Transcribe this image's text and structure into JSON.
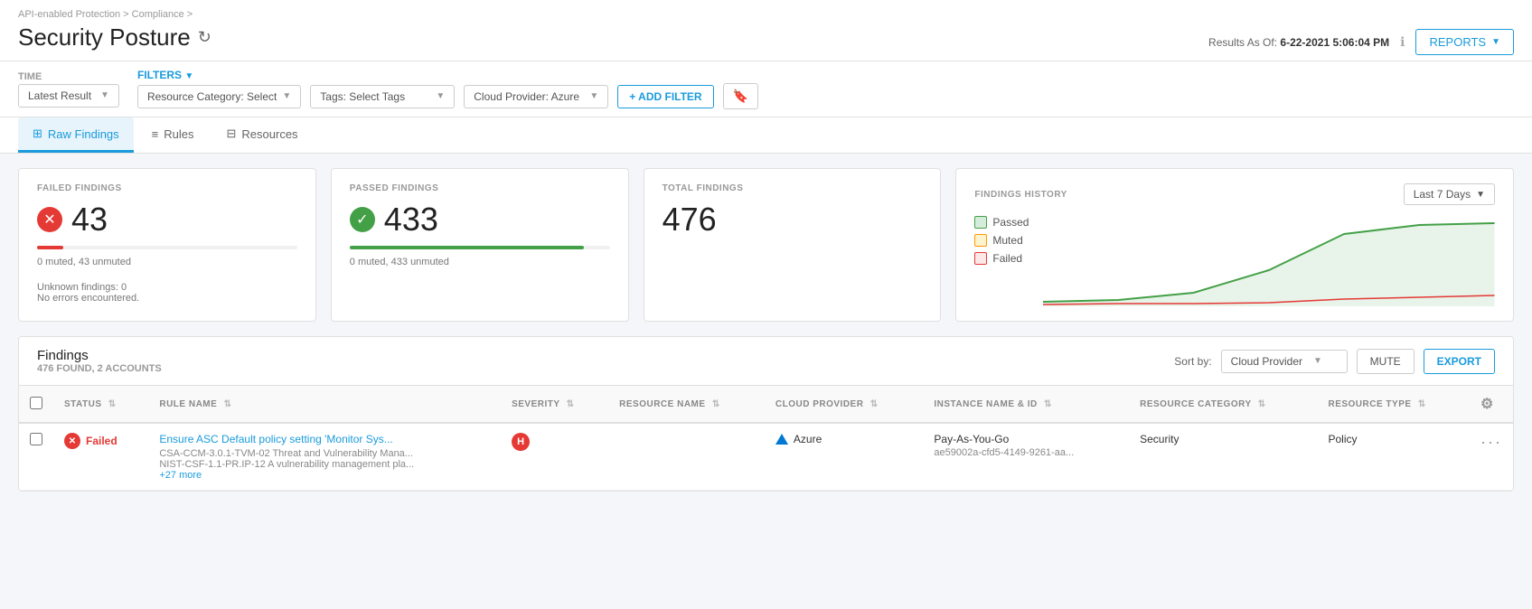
{
  "breadcrumb": {
    "text": "API-enabled Protection > Compliance >"
  },
  "page": {
    "title": "Security Posture",
    "results_as_of_label": "Results As Of:",
    "results_as_of_value": "6-22-2021 5:06:04 PM",
    "reports_button": "REPORTS"
  },
  "filters": {
    "time_label": "TIME",
    "filters_label": "FILTERS",
    "latest_result": "Latest Result",
    "resource_category": "Resource Category: Select",
    "tags": "Tags: Select Tags",
    "cloud_provider": "Cloud Provider: Azure",
    "add_filter": "+ ADD FILTER"
  },
  "tabs": {
    "raw_findings": "Raw Findings",
    "rules": "Rules",
    "resources": "Resources"
  },
  "stats": {
    "failed": {
      "label": "FAILED FINDINGS",
      "value": "43",
      "sub": "0 muted, 43 unmuted"
    },
    "passed": {
      "label": "PASSED FINDINGS",
      "value": "433",
      "sub": "0 muted, 433 unmuted"
    },
    "total": {
      "label": "TOTAL FINDINGS",
      "value": "476"
    },
    "unknown": "Unknown findings: 0",
    "no_errors": "No errors encountered."
  },
  "history": {
    "label": "FINDINGS HISTORY",
    "period": "Last 7 Days",
    "legend": {
      "passed": "Passed",
      "muted": "Muted",
      "failed": "Failed"
    }
  },
  "findings": {
    "title": "Findings",
    "subtitle": "476 FOUND, 2 ACCOUNTS",
    "sort_by_label": "Sort by:",
    "sort_value": "Cloud Provider",
    "mute_button": "MUTE",
    "export_button": "EXPORT",
    "columns": {
      "status": "STATUS",
      "rule_name": "RULE NAME",
      "severity": "SEVERITY",
      "resource_name": "RESOURCE NAME",
      "cloud_provider": "CLOUD PROVIDER",
      "instance_name_id": "INSTANCE NAME & ID",
      "resource_category": "RESOURCE CATEGORY",
      "resource_type": "RESOURCE TYPE"
    },
    "rows": [
      {
        "status": "Failed",
        "rule_name": "Ensure ASC Default policy setting 'Monitor Sys...",
        "rule_sub1": "CSA-CCM-3.0.1-TVM-02 Threat and Vulnerability Mana...",
        "rule_sub2": "NIST-CSF-1.1-PR.IP-12 A vulnerability management pla...",
        "rule_sub3": "+27 more",
        "severity": "H",
        "resource_name": "",
        "cloud_provider": "Azure",
        "instance_name": "Pay-As-You-Go",
        "instance_id": "ae59002a-cfd5-4149-9261-aa...",
        "resource_category": "Security",
        "resource_type": "Policy"
      }
    ]
  }
}
